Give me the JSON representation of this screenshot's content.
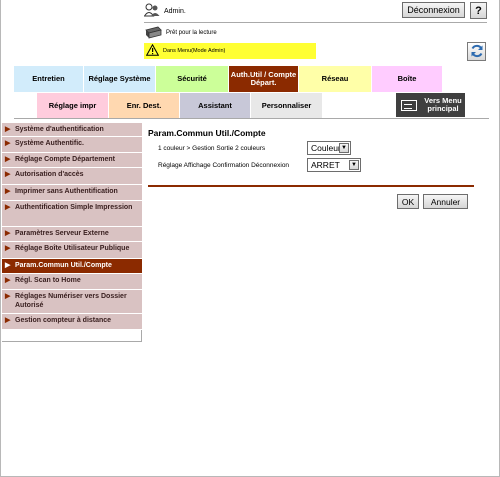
{
  "header": {
    "user": "Admin.",
    "logout_label": "Déconnexion",
    "help_label": "?",
    "status": "Prêt pour la lecture",
    "mode": "Dans Menu(Mode Admin)"
  },
  "tabs_row1": [
    {
      "label": "Entretien",
      "color": "#d2ecfb"
    },
    {
      "label": "Réglage Système",
      "color": "#d2ecfb"
    },
    {
      "label": "Sécurité",
      "color": "#ccff99"
    },
    {
      "label": "Auth.Util / Compte Départ.",
      "color": "#8b2a00",
      "active": true
    },
    {
      "label": "Réseau",
      "color": "#ffffa8"
    },
    {
      "label": "Boîte",
      "color": "#ffccff"
    }
  ],
  "tabs_row2": [
    {
      "label": "Réglage impr",
      "color": "#ffccdd"
    },
    {
      "label": "Enr. Dest.",
      "color": "#ffd8b0"
    },
    {
      "label": "Assistant",
      "color": "#c8c8d8"
    },
    {
      "label": "Personnaliser",
      "color": "#e8e8e8"
    }
  ],
  "menu_button": {
    "label": "Vers Menu principal"
  },
  "sidebar": {
    "items": [
      {
        "label": "Système d'authentification"
      },
      {
        "label": "Système Authentific."
      },
      {
        "label": "Réglage Compte Département"
      },
      {
        "label": "Autorisation d'accès"
      },
      {
        "label": "Imprimer sans Authentification"
      },
      {
        "label": "Authentification Simple Impression"
      },
      {
        "label": "Paramètres Serveur Externe"
      },
      {
        "label": "Réglage Boîte Utilisateur Publique"
      },
      {
        "label": "Param.Commun Util./Compte",
        "active": true
      },
      {
        "label": "Régl. Scan to Home"
      },
      {
        "label": "Réglages Numériser vers Dossier Autorisé"
      },
      {
        "label": "Gestion compteur à distance"
      }
    ]
  },
  "content": {
    "title": "Param.Commun Util./Compte",
    "rows": [
      {
        "label": "1 couleur > Gestion Sortie 2 couleurs",
        "value": "Couleur"
      },
      {
        "label": "Réglage Affichage Confirmation Déconnexion",
        "value": "ARRET"
      }
    ],
    "ok_label": "OK",
    "cancel_label": "Annuler"
  },
  "colors": {
    "accent": "#8b2a00",
    "sidebar_bg": "#d9c2c2",
    "mode_bar": "#ffff33"
  },
  "icons": {
    "user": "user-icon",
    "printer": "printer-icon",
    "warning": "warning-icon",
    "refresh": "refresh-icon",
    "menu": "menu-icon",
    "chevron": "chevron-down-icon",
    "arrow": "arrow-right-icon"
  }
}
